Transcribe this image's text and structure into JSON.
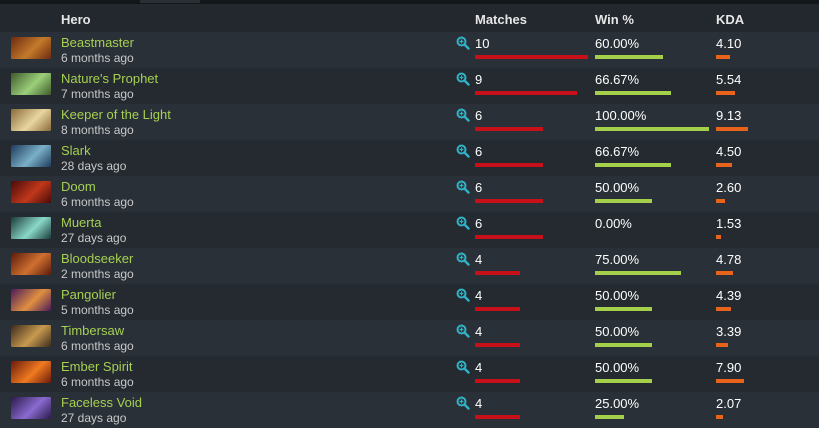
{
  "header": {
    "hero": "Hero",
    "matches": "Matches",
    "win": "Win %",
    "kda": "KDA"
  },
  "max_matches": 10,
  "max_kda": 9.13,
  "colors": {
    "hero_name": "#a5d152",
    "matches_bar": "#c8101a",
    "win_bar": "#a4d04a",
    "kda_bar": "#e8641d",
    "search_icon": "#2fb3c8"
  },
  "rows": [
    {
      "hero": "Beastmaster",
      "time": "6 months ago",
      "matches": "10",
      "win": "60.00%",
      "kda": "4.10",
      "icon": "beastmaster-portrait",
      "c1": "#6b2a10",
      "c2": "#c47a2a"
    },
    {
      "hero": "Nature's Prophet",
      "time": "7 months ago",
      "matches": "9",
      "win": "66.67%",
      "kda": "5.54",
      "icon": "natures-prophet-portrait",
      "c1": "#3e5a2a",
      "c2": "#9bd07a"
    },
    {
      "hero": "Keeper of the Light",
      "time": "8 months ago",
      "matches": "6",
      "win": "100.00%",
      "kda": "9.13",
      "icon": "keeper-of-the-light-portrait",
      "c1": "#8a6a3a",
      "c2": "#e8d6a0"
    },
    {
      "hero": "Slark",
      "time": "28 days ago",
      "matches": "6",
      "win": "66.67%",
      "kda": "4.50",
      "icon": "slark-portrait",
      "c1": "#1e3a5a",
      "c2": "#7ab0c8"
    },
    {
      "hero": "Doom",
      "time": "6 months ago",
      "matches": "6",
      "win": "50.00%",
      "kda": "2.60",
      "icon": "doom-portrait",
      "c1": "#4a0a0a",
      "c2": "#c0381a"
    },
    {
      "hero": "Muerta",
      "time": "27 days ago",
      "matches": "6",
      "win": "0.00%",
      "kda": "1.53",
      "icon": "muerta-portrait",
      "c1": "#1a3a3a",
      "c2": "#8ad8c8"
    },
    {
      "hero": "Bloodseeker",
      "time": "2 months ago",
      "matches": "4",
      "win": "75.00%",
      "kda": "4.78",
      "icon": "bloodseeker-portrait",
      "c1": "#5a1a0a",
      "c2": "#d07030"
    },
    {
      "hero": "Pangolier",
      "time": "5 months ago",
      "matches": "4",
      "win": "50.00%",
      "kda": "4.39",
      "icon": "pangolier-portrait",
      "c1": "#4a1a5a",
      "c2": "#e09040"
    },
    {
      "hero": "Timbersaw",
      "time": "6 months ago",
      "matches": "4",
      "win": "50.00%",
      "kda": "3.39",
      "icon": "timbersaw-portrait",
      "c1": "#3a2a1a",
      "c2": "#c89a50"
    },
    {
      "hero": "Ember Spirit",
      "time": "6 months ago",
      "matches": "4",
      "win": "50.00%",
      "kda": "7.90",
      "icon": "ember-spirit-portrait",
      "c1": "#6a1a0a",
      "c2": "#f07a20"
    },
    {
      "hero": "Faceless Void",
      "time": "27 days ago",
      "matches": "4",
      "win": "25.00%",
      "kda": "2.07",
      "icon": "faceless-void-portrait",
      "c1": "#2a1a4a",
      "c2": "#8a6ad0"
    }
  ]
}
